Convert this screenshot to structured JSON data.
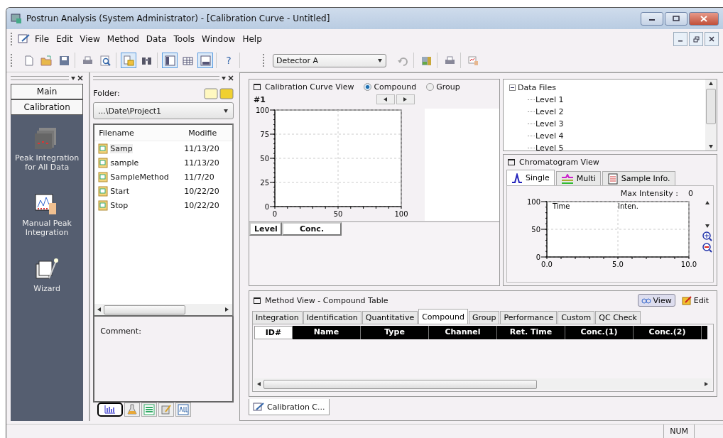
{
  "window": {
    "title": "Postrun Analysis (System Administrator) - [Calibration Curve - Untitled]"
  },
  "menu": [
    "File",
    "Edit",
    "View",
    "Method",
    "Data",
    "Tools",
    "Window",
    "Help"
  ],
  "toolbar": [
    [
      {
        "kind": "new",
        "pressed": false
      },
      {
        "kind": "open",
        "pressed": false
      },
      {
        "kind": "save",
        "pressed": false
      }
    ],
    [
      {
        "kind": "print",
        "pressed": false
      },
      {
        "kind": "preview",
        "pressed": false
      }
    ],
    [
      {
        "kind": "files",
        "pressed": true
      },
      {
        "kind": "find",
        "pressed": false
      }
    ],
    [
      {
        "kind": "panel",
        "pressed": true
      },
      {
        "kind": "table",
        "pressed": false
      },
      {
        "kind": "chart",
        "pressed": true
      }
    ],
    [
      {
        "kind": "help",
        "label": "?",
        "pressed": false
      }
    ]
  ],
  "detector": {
    "value": "Detector A"
  },
  "toolbar2": [
    [
      {
        "kind": "undo",
        "pressed": false
      }
    ],
    [
      {
        "kind": "calc",
        "pressed": false
      }
    ],
    [
      {
        "kind": "report",
        "pressed": false
      }
    ],
    [
      {
        "kind": "manual",
        "pressed": false
      }
    ]
  ],
  "nav": {
    "tabs": [
      "Main",
      "Calibration"
    ],
    "items": [
      {
        "kind": "peak",
        "label": "Peak Integration for All Data"
      },
      {
        "kind": "manual",
        "label": "Manual Peak Integration"
      },
      {
        "kind": "wizard",
        "label": "Wizard"
      }
    ]
  },
  "folder": {
    "label": "Folder:",
    "path": "...\\Date\\Project1",
    "columns": [
      "Filename",
      "Modifie"
    ],
    "files": [
      {
        "name": "Samp",
        "modified": "11/13/20",
        "selected": true
      },
      {
        "name": "sample",
        "modified": "11/13/20",
        "selected": false
      },
      {
        "name": "SampleMethod",
        "modified": "11/7/20",
        "selected": false
      },
      {
        "name": "Start",
        "modified": "10/22/20",
        "selected": false
      },
      {
        "name": "Stop",
        "modified": "10/22/20",
        "selected": false
      }
    ],
    "comment_label": "Comment:",
    "tabs": [
      {
        "kind": "chart",
        "selected": true
      },
      {
        "kind": "flask",
        "selected": false
      },
      {
        "kind": "list",
        "selected": false
      },
      {
        "kind": "tool",
        "selected": false
      },
      {
        "kind": "all",
        "selected": false
      }
    ]
  },
  "calibration_view": {
    "title": "Calibration Curve View",
    "modes": [
      {
        "label": "Compound",
        "selected": true
      },
      {
        "label": "Group",
        "selected": false
      }
    ],
    "compound": "#1",
    "chart_data": {
      "type": "line",
      "grid": true,
      "xlim": [
        0,
        100
      ],
      "ylim": [
        0,
        100
      ],
      "xticks": [
        0,
        50,
        100
      ],
      "yticks": [
        0,
        25,
        50,
        75,
        100
      ]
    },
    "columns": [
      "Level",
      "Conc."
    ]
  },
  "data_files": {
    "label": "Data Files",
    "expanded": true,
    "children": [
      {
        "label": "Level 1"
      },
      {
        "label": "Level 2"
      },
      {
        "label": "Level 3"
      },
      {
        "label": "Level 4"
      },
      {
        "label": "Level 5"
      }
    ]
  },
  "chromatogram_view": {
    "title": "Chromatogram View",
    "tabs": [
      {
        "kind": "single",
        "label": "Single",
        "selected": true
      },
      {
        "kind": "multi",
        "label": "Multi",
        "selected": false
      },
      {
        "kind": "info",
        "label": "Sample Info.",
        "selected": false
      }
    ],
    "max_intensity_label": "Max Intensity :",
    "max_intensity": "0",
    "columns": [
      "Time",
      "Inten."
    ],
    "chart_data": {
      "type": "line",
      "grid": true,
      "xlim": [
        0,
        10
      ],
      "ylim": [
        0,
        100
      ],
      "xticks": [
        {
          "value": 0,
          "label": "0.0"
        },
        {
          "value": 5,
          "label": "5.0"
        },
        {
          "value": 10,
          "label": "10.0"
        }
      ],
      "yticks": [
        0,
        50,
        100
      ]
    }
  },
  "method_view": {
    "title": "Method View - Compound Table",
    "buttons": [
      {
        "kind": "view",
        "label": "View",
        "pressed": true
      },
      {
        "kind": "edit",
        "label": "Edit",
        "pressed": false
      }
    ],
    "tabs": [
      {
        "label": "Integration",
        "selected": false
      },
      {
        "label": "Identification",
        "selected": false
      },
      {
        "label": "Quantitative",
        "selected": false
      },
      {
        "label": "Compound",
        "selected": true
      },
      {
        "label": "Group",
        "selected": false
      },
      {
        "label": "Performance",
        "selected": false
      },
      {
        "label": "Custom",
        "selected": false
      },
      {
        "label": "QC Check",
        "selected": false
      }
    ],
    "columns": [
      "ID#",
      "Name",
      "Type",
      "Channel",
      "Ret. Time",
      "Conc.(1)",
      "Conc.(2)"
    ]
  },
  "document_tab": "Calibration C...",
  "status_bar": {
    "num": "NUM"
  }
}
